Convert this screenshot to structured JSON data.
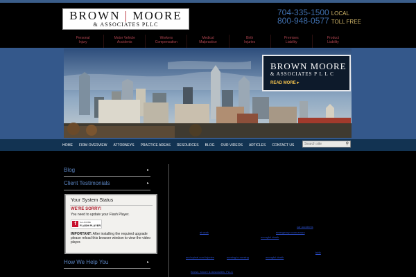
{
  "header": {
    "logo": {
      "name_left": "BROWN",
      "name_right": "MOORE",
      "sub": "& ASSOCIATES PLLC"
    },
    "phones": [
      {
        "number": "704-335-1500",
        "label": "LOCAL"
      },
      {
        "number": "800-948-0577",
        "label": "TOLL FREE"
      }
    ]
  },
  "practice_nav": [
    {
      "line1": "Personal",
      "line2": "Injury"
    },
    {
      "line1": "Motor Vehicle",
      "line2": "Accidents"
    },
    {
      "line1": "Workers",
      "line2": "Compensation"
    },
    {
      "line1": "Medical",
      "line2": "Malpractice"
    },
    {
      "line1": "Birth",
      "line2": "Injuries"
    },
    {
      "line1": "Premises",
      "line2": "Liability"
    },
    {
      "line1": "Product",
      "line2": "Liability"
    }
  ],
  "hero": {
    "promo_title": "BROWN MOORE",
    "promo_sub": "& ASSOCIATES P L L C",
    "read_more": "READ MORE"
  },
  "main_nav": [
    "HOME",
    "FIRM OVERVIEW",
    "ATTORNEYS",
    "PRACTICE AREAS",
    "RESOURCES",
    "BLOG",
    "OUR VIDEOS",
    "ARTICLES",
    "CONTACT US"
  ],
  "search": {
    "placeholder": "Search site"
  },
  "sidebar": {
    "blog": "Blog",
    "testimonials": "Client Testimonials",
    "help": "How We Help You",
    "status": {
      "title": "Your System Status",
      "sorry": "WE'RE SORRY!",
      "message": "You need to update your Flash Player.",
      "badge_line1": "Get ADOBE",
      "badge_line2": "FLASH PLAYER",
      "important_label": "IMPORTANT:",
      "important_text": "After installing the required upgrade please reload this browser window to view the video player."
    }
  },
  "content_links": {
    "car_accidents": "car accidents",
    "at_work": "at work",
    "emergency_room_errors": "emergency room errors",
    "wrongful_death": "wrongful death",
    "birth": "birth",
    "brain_injuries": "and spinal cord injuries",
    "nursing_homes": "nursing to nursing",
    "wrongful_death2": "wrongful death",
    "firm": "Brown, Moore & Associates, PLLC"
  },
  "colors": {
    "accent_blue": "#34588b",
    "nav_bg": "#123352",
    "phone_blue": "#3f6fae",
    "gold": "#d2b76a",
    "red": "#b4202a"
  }
}
